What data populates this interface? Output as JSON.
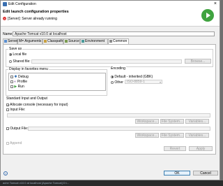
{
  "window": {
    "title": "Edit Configuration"
  },
  "header": {
    "title": "Edit launch configuration properties",
    "error": "[Server]: Server already running"
  },
  "name": {
    "label": "Name:",
    "value": "Apache Tomcat v10.0  at localhost"
  },
  "tabs": [
    {
      "label": "Server"
    },
    {
      "label": "Arguments",
      "prefix": "M="
    },
    {
      "label": "Classpath"
    },
    {
      "label": "Source"
    },
    {
      "label": "Environment"
    },
    {
      "label": "Common"
    }
  ],
  "save_as": {
    "label": "Save as",
    "local": "Local file",
    "shared": "Shared file:",
    "browse": "Browse..."
  },
  "favorites": {
    "label": "Display in favorites menu",
    "items": [
      "Debug",
      "Profile",
      "Run"
    ]
  },
  "encoding": {
    "label": "Encoding",
    "default": "Default - inherited (GBK)",
    "other": "Other",
    "other_value": "ISO-8859-1"
  },
  "std": {
    "label": "Standard Input and Output",
    "allocate": "Allocate console (necessary for input)",
    "input_file": "Input File:",
    "output_file": "Output File:",
    "workspace": "Workspace...",
    "file_system": "File System...",
    "variables": "Variables...",
    "append": "Append"
  },
  "panel_buttons": {
    "revert": "Revert",
    "apply": "Apply"
  },
  "footer": {
    "ok": "OK",
    "cancel": "Cancel"
  },
  "background_text": "ache Tomcat v10.0 at localhost [Apache Tomcat] D:\\..."
}
